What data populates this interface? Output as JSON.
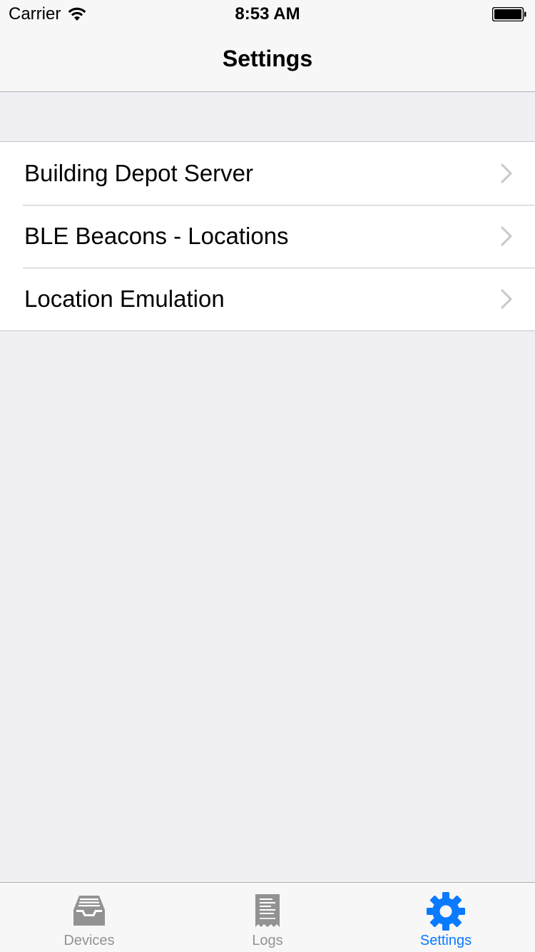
{
  "status_bar": {
    "carrier": "Carrier",
    "time": "8:53 AM",
    "wifi_icon": "wifi-icon",
    "battery_icon": "battery-icon"
  },
  "nav": {
    "title": "Settings"
  },
  "settings_list": {
    "items": [
      {
        "label": "Building Depot Server",
        "icon": "chevron-right-icon"
      },
      {
        "label": "BLE Beacons - Locations",
        "icon": "chevron-right-icon"
      },
      {
        "label": "Location Emulation",
        "icon": "chevron-right-icon"
      }
    ]
  },
  "tab_bar": {
    "tabs": [
      {
        "label": "Devices",
        "icon": "inbox-tray-icon",
        "active": false
      },
      {
        "label": "Logs",
        "icon": "receipt-icon",
        "active": false
      },
      {
        "label": "Settings",
        "icon": "gear-icon",
        "active": true
      }
    ]
  },
  "colors": {
    "accent": "#0a7aff",
    "background": "#efeff4",
    "inactive_tab": "#929292"
  }
}
